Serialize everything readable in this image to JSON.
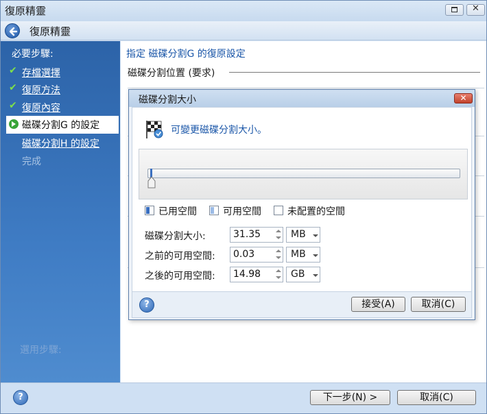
{
  "window": {
    "title": "復原精靈"
  },
  "header": {
    "title": "復原精靈"
  },
  "sidebar": {
    "heading": "必要步驟:",
    "steps": [
      {
        "label": "存檔選擇",
        "state": "done"
      },
      {
        "label": "復原方法",
        "state": "done"
      },
      {
        "label": "復原內容",
        "state": "done"
      },
      {
        "label": "磁碟分割G 的設定",
        "state": "current"
      },
      {
        "label": "磁碟分割H 的設定",
        "state": "pending"
      },
      {
        "label": "完成",
        "state": "disabled"
      }
    ],
    "faded_heading": "選用步驟:"
  },
  "content": {
    "subtitle": "指定 磁碟分割G 的復原設定",
    "section_title": "磁碟分割位置 (要求)"
  },
  "dialog": {
    "title": "磁碟分割大小",
    "message": "可變更磁碟分割大小。",
    "slider_fraction": 0.0,
    "legend": {
      "used": "已用空間",
      "free": "可用空間",
      "unallocated": "未配置的空間"
    },
    "fields": {
      "partition_size": {
        "label": "磁碟分割大小:",
        "value": "31.35",
        "unit": "MB"
      },
      "free_before": {
        "label": "之前的可用空間:",
        "value": "0.03",
        "unit": "MB"
      },
      "free_after": {
        "label": "之後的可用空間:",
        "value": "14.98",
        "unit": "GB"
      }
    },
    "buttons": {
      "accept": "接受(A)",
      "cancel": "取消(C)"
    }
  },
  "footer": {
    "next": "下一步(N) >",
    "cancel": "取消(C)"
  },
  "colors": {
    "sidebar": "#2c63a8",
    "accent_text": "#1a56a8",
    "check": "#7ee04a"
  }
}
